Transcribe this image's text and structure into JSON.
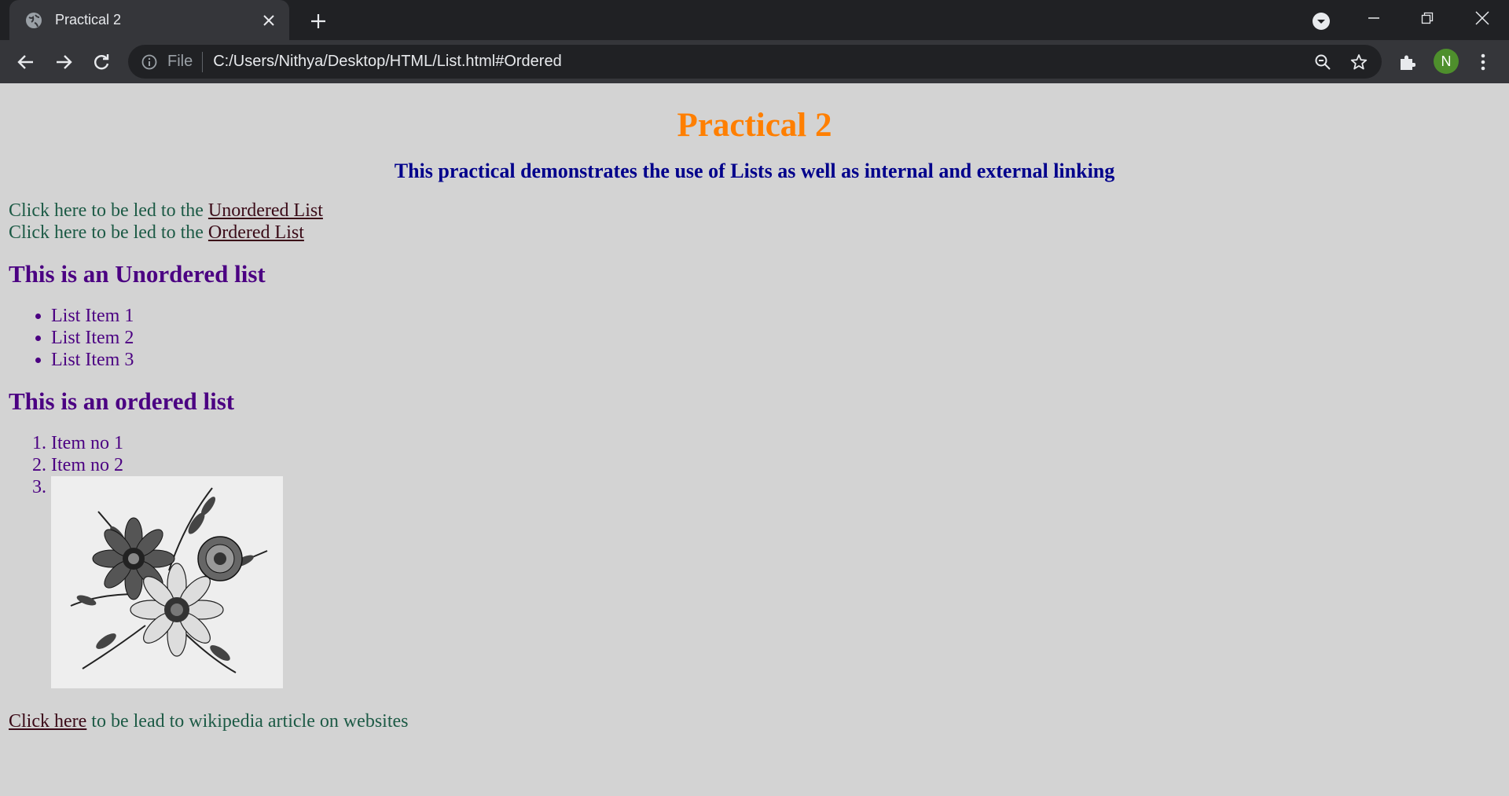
{
  "browser": {
    "tab_title": "Practical 2",
    "omnibox_scheme": "File",
    "url": "C:/Users/Nithya/Desktop/HTML/List.html#Ordered",
    "avatar_initial": "N"
  },
  "page": {
    "title": "Practical 2",
    "subtitle": "This practical demonstrates the use of Lists as well as internal and external linking",
    "link_lines": [
      {
        "prefix": "Click here to be led to the ",
        "link": "Unordered List"
      },
      {
        "prefix": "Click here to be led to the ",
        "link": "Ordered List"
      }
    ],
    "unordered_heading": "This is an Unordered list",
    "unordered_items": [
      "List Item 1",
      "List Item 2",
      "List Item 3"
    ],
    "ordered_heading": "This is an ordered list",
    "ordered_items": [
      "Item no 1",
      "Item no 2"
    ],
    "footer_link": "Click here",
    "footer_text": " to be lead to wikipedia article on websites"
  },
  "colors": {
    "title": "#ff7f00",
    "subtitle": "#00008b",
    "heading": "#4b0082",
    "body_text": "#1c5a45",
    "link": "#3a0a17",
    "background": "#d3d3d3"
  }
}
